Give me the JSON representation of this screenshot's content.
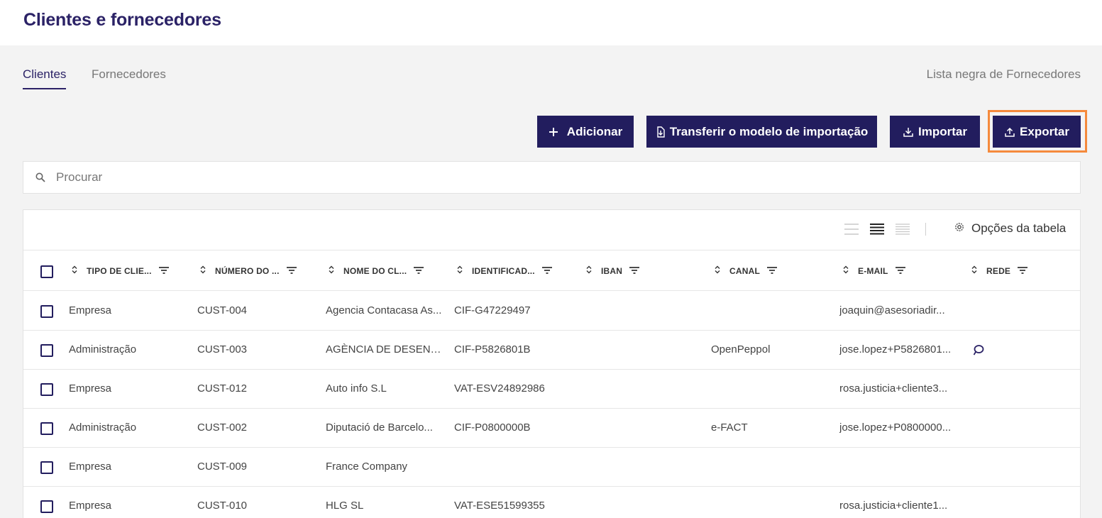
{
  "page": {
    "title": "Clientes e fornecedores"
  },
  "tabs": [
    {
      "label": "Clientes",
      "active": true
    },
    {
      "label": "Fornecedores",
      "active": false
    }
  ],
  "blacklist_link": "Lista negra de Fornecedores",
  "actions": {
    "add": {
      "label": "Adicionar",
      "icon": "plus-icon"
    },
    "template": {
      "label": "Transferir o modelo de importação",
      "icon": "file-download-icon"
    },
    "import": {
      "label": "Importar",
      "icon": "download-icon"
    },
    "export": {
      "label": "Exportar",
      "icon": "upload-icon"
    }
  },
  "search": {
    "placeholder": "Procurar",
    "value": ""
  },
  "toolbar": {
    "table_options_label": "Opções da tabela"
  },
  "columns": [
    "TIPO DE CLIE...",
    "NÚMERO DO ...",
    "NOME DO CL...",
    "IDENTIFICAD...",
    "IBAN",
    "CANAL",
    "E-MAIL",
    "REDE"
  ],
  "rows": [
    {
      "type": "Empresa",
      "number": "CUST-004",
      "name": "Agencia Contacasa As...",
      "id": "CIF-G47229497",
      "iban": "",
      "channel": "",
      "email": "joaquin@asesoriadir...",
      "network": ""
    },
    {
      "type": "Administração",
      "number": "CUST-003",
      "name": "AGÈNCIA DE DESENV...",
      "id": "CIF-P5826801B",
      "iban": "",
      "channel": "OpenPeppol",
      "email": "jose.lopez+P5826801...",
      "network": "peppol-icon"
    },
    {
      "type": "Empresa",
      "number": "CUST-012",
      "name": "Auto info S.L",
      "id": "VAT-ESV24892986",
      "iban": "",
      "channel": "",
      "email": "rosa.justicia+cliente3...",
      "network": ""
    },
    {
      "type": "Administração",
      "number": "CUST-002",
      "name": "Diputació de Barcelo...",
      "id": "CIF-P0800000B",
      "iban": "",
      "channel": "e-FACT",
      "email": "jose.lopez+P0800000...",
      "network": ""
    },
    {
      "type": "Empresa",
      "number": "CUST-009",
      "name": "France Company",
      "id": "",
      "iban": "",
      "channel": "",
      "email": "",
      "network": ""
    },
    {
      "type": "Empresa",
      "number": "CUST-010",
      "name": "HLG SL",
      "id": "VAT-ESE51599355",
      "iban": "",
      "channel": "",
      "email": "rosa.justicia+cliente1...",
      "network": ""
    }
  ],
  "colors": {
    "primary": "#221d5e",
    "title": "#2b2266",
    "highlight": "#f58a3c",
    "background": "#f3f3f3"
  }
}
